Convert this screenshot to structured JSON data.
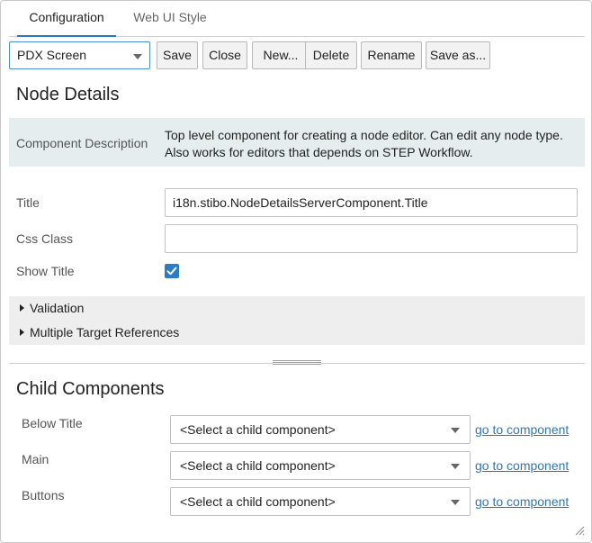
{
  "tabs": [
    {
      "label": "Configuration",
      "active": true
    },
    {
      "label": "Web UI Style",
      "active": false
    }
  ],
  "toolbar": {
    "screen_select": "PDX Screen",
    "buttons": [
      "Save",
      "Close",
      "New...",
      "Delete",
      "Rename",
      "Save as..."
    ]
  },
  "node_details": {
    "title": "Node Details",
    "component_description_label": "Component Description",
    "component_description": "Top level component for creating a node editor. Can edit any node type. Also works for editors that depends on STEP Workflow.",
    "fields": {
      "title_label": "Title",
      "title_value": "i18n.stibo.NodeDetailsServerComponent.Title",
      "css_class_label": "Css Class",
      "css_class_value": "",
      "show_title_label": "Show Title",
      "show_title_checked": true
    },
    "collapsibles": [
      "Validation",
      "Multiple Target References"
    ]
  },
  "child_components": {
    "title": "Child Components",
    "rows": [
      {
        "label": "Below Title",
        "select": "<Select a child component>",
        "link": "go to component"
      },
      {
        "label": "Main",
        "select": "<Select a child component>",
        "link": "go to component"
      },
      {
        "label": "Buttons",
        "select": "<Select a child component>",
        "link": "go to component"
      }
    ]
  },
  "colors": {
    "accent": "#2a78c0",
    "description_bg": "#e5edef",
    "collapsible_bg": "#eeeeee"
  },
  "icons": {
    "dropdown": "chevron-down-icon",
    "expand": "triangle-right-icon",
    "check": "check-icon",
    "resize": "resize-grip-icon"
  }
}
